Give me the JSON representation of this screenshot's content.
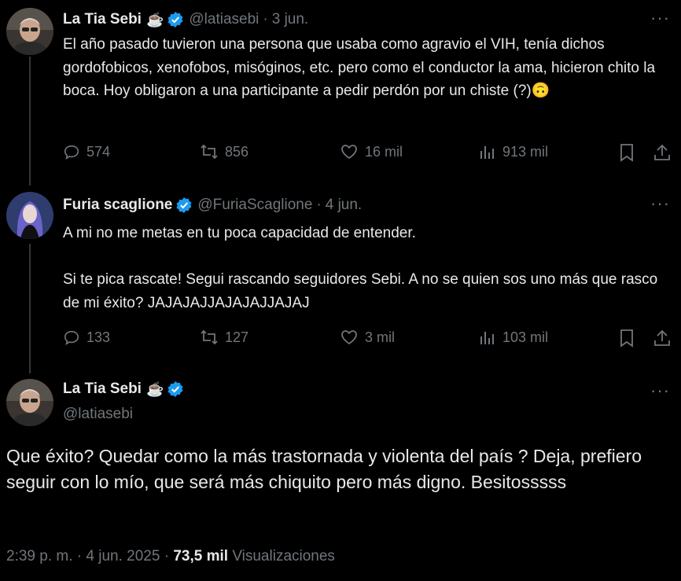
{
  "tweets": [
    {
      "name": "La Tia Sebi",
      "name_emoji": "☕",
      "handle": "@latiasebi",
      "date": "3 jun.",
      "text": "El año pasado tuvieron una persona que usaba como agravio el VIH, tenía dichos gordofobicos, xenofobos, misóginos, etc. pero como el conductor la ama, hicieron chito la boca. Hoy obligaron a una participante a pedir perdón por un chiste (?)🙃",
      "replies": "574",
      "reposts": "856",
      "likes": "16 mil",
      "views": "913 mil"
    },
    {
      "name": "Furia scaglione",
      "handle": "@FuriaScaglione",
      "date": "4 jun.",
      "text": "A mi no me metas en tu poca capacidad de entender.\n\nSi te pica rascate! Segui rascando seguidores Sebi. A no se quien sos uno más que rasco de mi éxito? JAJAJAJJAJAJAJJAJAJ",
      "replies": "133",
      "reposts": "127",
      "likes": "3 mil",
      "views": "103 mil"
    }
  ],
  "main": {
    "name": "La Tia Sebi",
    "name_emoji": "☕",
    "handle": "@latiasebi",
    "text": "Que éxito? Quedar como la más trastornada y violenta del país ? Deja, prefiero seguir con lo mío, que será más chiquito pero más digno. Besitosssss",
    "time": "2:39 p. m.",
    "date": "4 jun. 2025",
    "views_count": "73,5 mil",
    "views_label": "Visualizaciones"
  },
  "ui": {
    "separator": "·",
    "more": "···"
  },
  "colors": {
    "background": "#000000",
    "text": "#e7e9ea",
    "muted": "#71767b",
    "verified": "#1d9bf0"
  },
  "icons": [
    "reply-icon",
    "repost-icon",
    "like-icon",
    "views-icon",
    "bookmark-icon",
    "share-icon",
    "verified-badge-icon",
    "more-icon"
  ]
}
